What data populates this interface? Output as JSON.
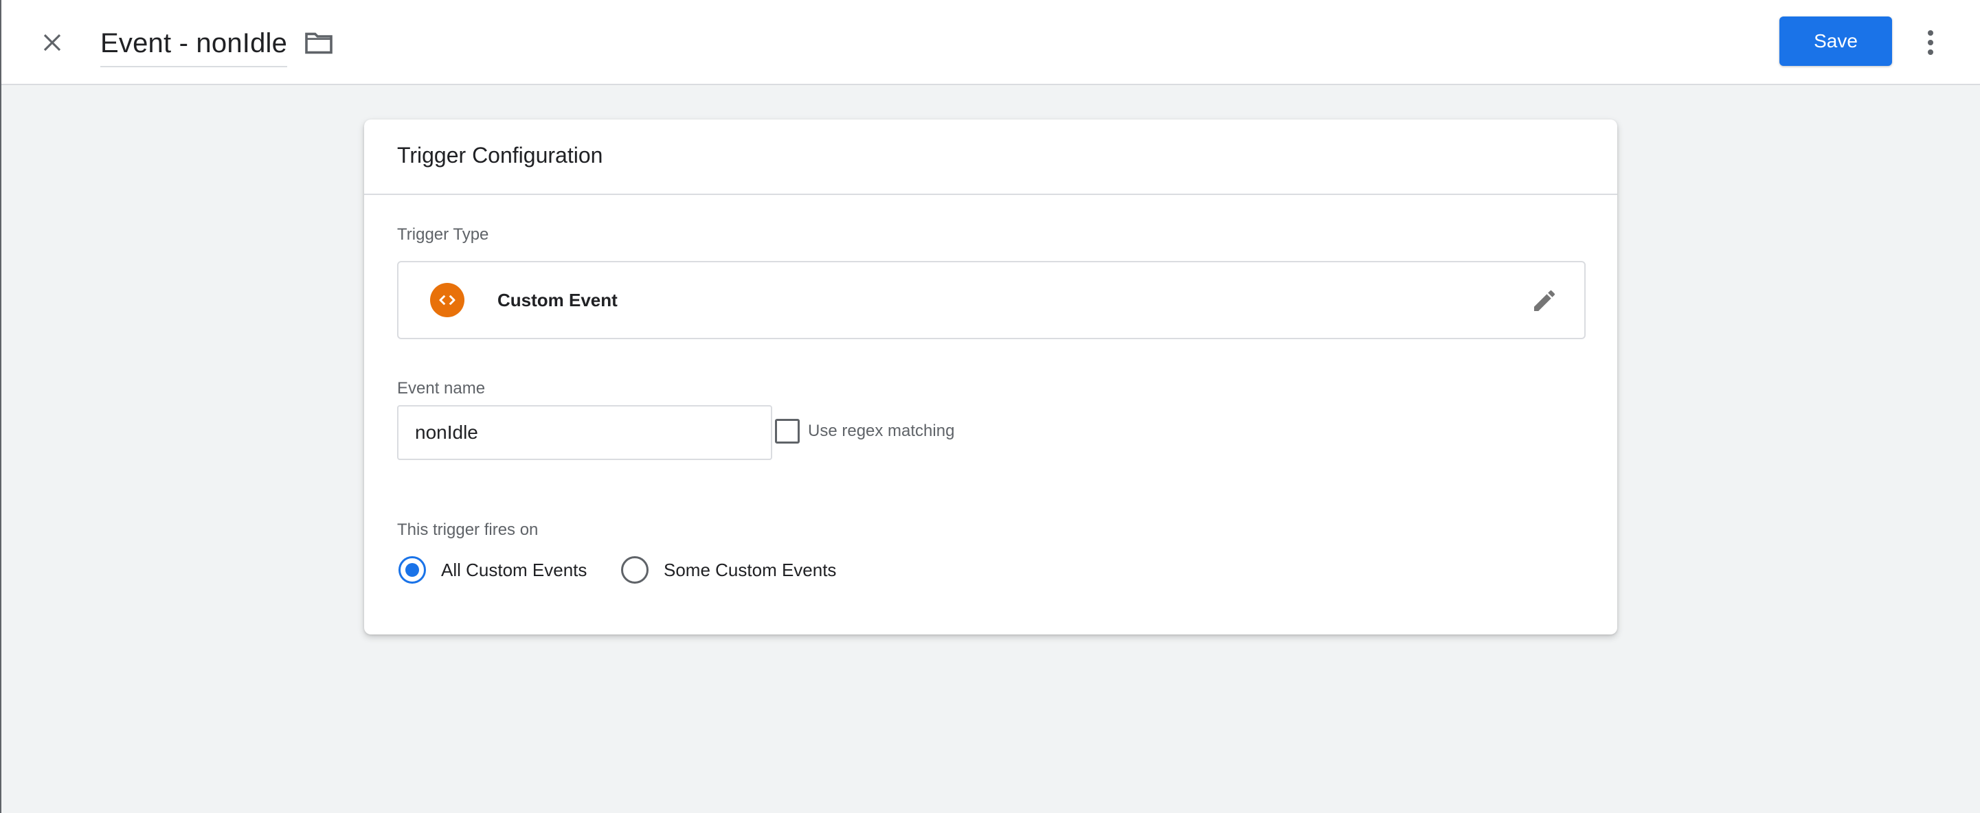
{
  "header": {
    "title": "Event - nonIdle",
    "save_label": "Save"
  },
  "card": {
    "title": "Trigger Configuration",
    "trigger_type_label": "Trigger Type",
    "trigger_type_name": "Custom Event",
    "event_name_label": "Event name",
    "event_name_value": "nonIdle",
    "regex_label": "Use regex matching",
    "regex_checked": false,
    "fires_on_label": "This trigger fires on",
    "fires_on_options": [
      {
        "label": "All Custom Events",
        "selected": true
      },
      {
        "label": "Some Custom Events",
        "selected": false
      }
    ]
  },
  "icons": {
    "close": "close-icon",
    "folder": "folder-icon",
    "more": "more-vert-icon",
    "trigger_type": "code-icon",
    "edit": "pencil-icon"
  },
  "colors": {
    "accent": "#1a73e8",
    "custom_event_icon": "#e8710a",
    "background": "#f1f3f4"
  }
}
